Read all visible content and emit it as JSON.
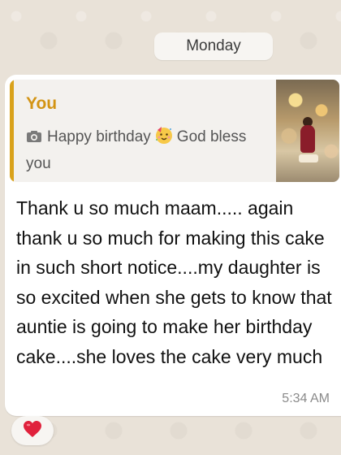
{
  "date_separator": "Monday",
  "message": {
    "quoted": {
      "author": "You",
      "text_before_emoji": "Happy birthday",
      "text_after_emoji": "God bless",
      "text_line2": "you",
      "media_icon": "camera-icon",
      "emoji_icon": "partying-face-icon"
    },
    "text": "Thank u so much maam..... again thank u so much for making this cake in such short notice....my daughter is so excited when she gets to know that auntie is going to make her birthday cake....she loves the cake very much",
    "time": "5:34 AM",
    "reaction_icon": "red-heart-icon"
  },
  "colors": {
    "quote_accent": "#d9a21b",
    "author_color": "#d39414",
    "heart": "#e0213c",
    "chat_background": "#e9e2d8"
  }
}
